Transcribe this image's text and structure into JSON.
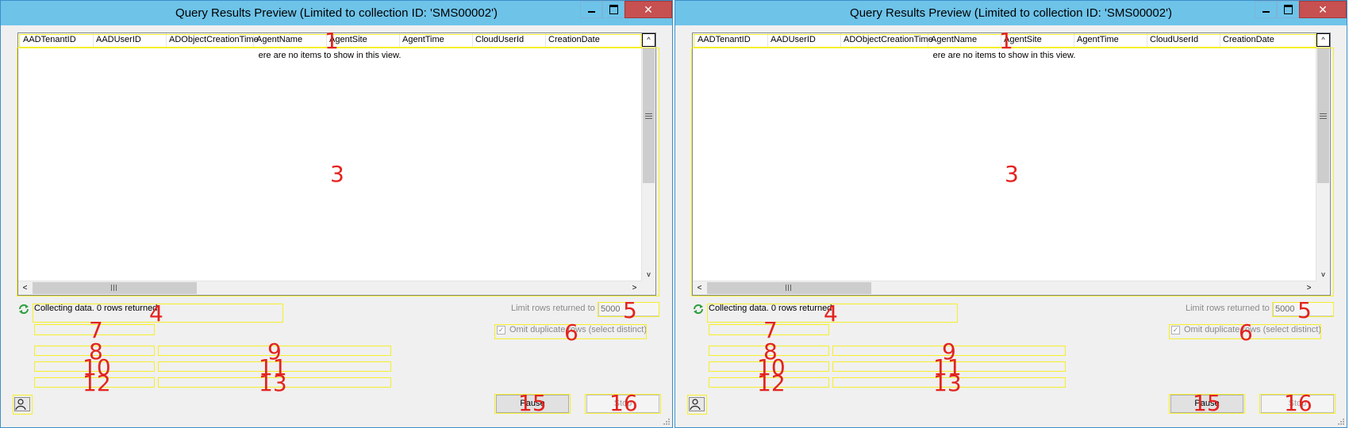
{
  "window_title": "Query Results Preview (Limited to collection ID: 'SMS00002')",
  "title_buttons": {
    "minimize": "—",
    "maximize": "□",
    "close": "✕"
  },
  "columns": [
    "AADTenantID",
    "AADUserID",
    "ADObjectCreationTime",
    "AgentName",
    "AgentSite",
    "AgentTime",
    "CloudUserId",
    "CreationDate"
  ],
  "empty_message": "ere are no items to show in this view.",
  "status_text": "Collecting data. 0 rows returned.",
  "limit_label": "Limit rows returned to",
  "limit_value": "5000",
  "omit_label": "Omit duplicate rows (select distinct)",
  "omit_checked": true,
  "pause_label": "Pause",
  "stop_label": "Stop",
  "scroll_glyphs": {
    "up": "^",
    "down": "v",
    "left": "<",
    "right": ">"
  },
  "left_panel_numbers": [
    "1",
    "3",
    "4",
    "5",
    "6",
    "7",
    "8",
    "9",
    "10",
    "11",
    "12",
    "13",
    "15",
    "16"
  ],
  "right_panel_numbers": [
    "1",
    "3",
    "4",
    "5",
    "6",
    "7",
    "8",
    "9",
    "10",
    "11",
    "12",
    "13",
    "15",
    "16"
  ],
  "overlay_color": "#f5ef2a",
  "number_color": "#e3231f",
  "title_bar_color": "#6ec3e9",
  "close_button_color": "#c75050"
}
